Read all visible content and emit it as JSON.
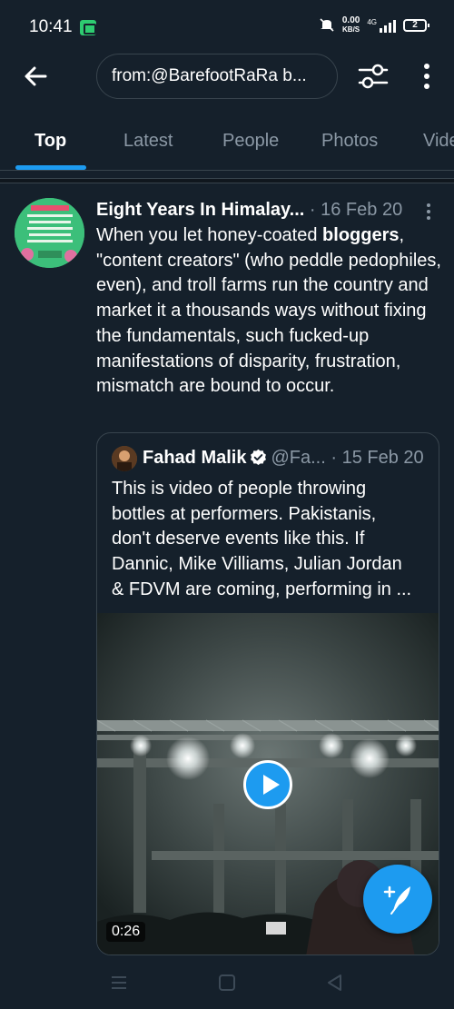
{
  "status_bar": {
    "time": "10:41",
    "net_speed_value": "0.00",
    "net_speed_unit": "KB/S",
    "network_type": "4G",
    "battery_level": "2",
    "icons": [
      "app-notification-icon",
      "mute-icon",
      "signal-icon",
      "battery-icon"
    ]
  },
  "header": {
    "search_text": "from:@BarefootRaRa b...",
    "icons": [
      "back-arrow-icon",
      "filter-icon",
      "more-vertical-icon"
    ]
  },
  "tabs": [
    {
      "label": "Top",
      "active": true
    },
    {
      "label": "Latest",
      "active": false
    },
    {
      "label": "People",
      "active": false
    },
    {
      "label": "Photos",
      "active": false
    },
    {
      "label": "Vide",
      "active": false
    }
  ],
  "tweet": {
    "author_name": "Eight Years In Himalay...",
    "meta": " · 16 Feb 20",
    "body_before": "When you let honey-coated ",
    "body_bold": "bloggers",
    "body_after": ", \"content creators\" (who peddle pedophiles, even), and troll farms run the country and market it a thousands ways without fixing the fundamentals, such fucked-up manifestations of disparity, frustration, mismatch are bound to occur.",
    "quote": {
      "author_name": "Fahad Malik",
      "verified": true,
      "meta": "@Fa... · 15 Feb 20",
      "body_lines": [
        "This is video of people throwing",
        "bottles at performers. Pakistanis,",
        "don't deserve events like this. If",
        "Dannic, Mike Villiams, Julian Jordan",
        "& FDVM are coming, performing in ..."
      ],
      "video_duration": "0:26"
    }
  },
  "colors": {
    "background": "#15202b",
    "accent": "#1d9bf0",
    "secondary_text": "#8b98a5",
    "border": "#38444d"
  }
}
